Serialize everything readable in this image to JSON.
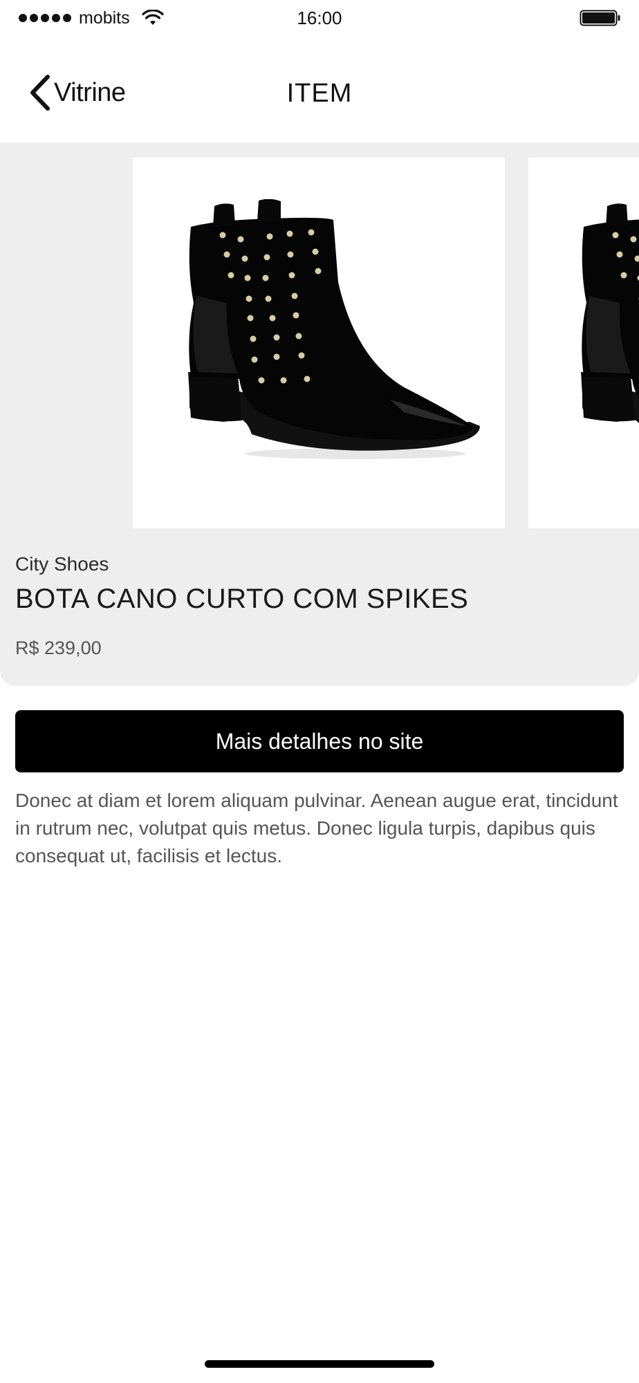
{
  "status_bar": {
    "carrier": "mobits",
    "time": "16:00",
    "signal_icon": "signal-dots-icon",
    "wifi_icon": "wifi-icon",
    "battery_icon": "battery-icon"
  },
  "nav": {
    "back_label": "Vitrine",
    "back_icon": "chevron-left-icon",
    "title": "ITEM"
  },
  "product": {
    "brand": "City Shoes",
    "name": "BOTA CANO CURTO COM SPIKES",
    "price": "R$ 239,00",
    "image_icon": "boot-image"
  },
  "cta": {
    "label": "Mais detalhes no site"
  },
  "description": "Donec at diam et lorem aliquam pulvinar. Aenean augue erat, tincidunt in rutrum nec, volutpat quis metus. Donec ligula turpis, dapibus quis consequat ut, facilisis et lectus.",
  "colors": {
    "card_background": "#eeeeee",
    "cta_background": "#000000",
    "cta_text": "#ffffff",
    "text_secondary": "#555555"
  }
}
